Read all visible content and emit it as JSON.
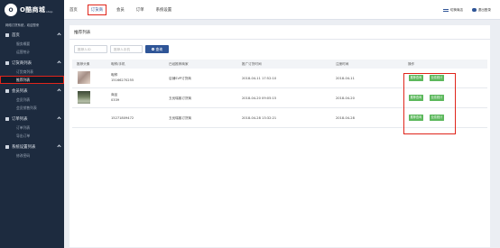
{
  "logo": {
    "mark": "O",
    "title": "O酷商城",
    "sub": "shop"
  },
  "sidebar": {
    "welcome": "网络订货系统，欢迎您来",
    "groups": [
      {
        "label": "首页",
        "items": [
          "服务概要",
          "运营统计"
        ]
      },
      {
        "label": "订货商列表",
        "items": [
          "订货商列表",
          "推荐列表"
        ]
      },
      {
        "label": "会员列表",
        "items": [
          "会员列表",
          "会员销售列表"
        ]
      },
      {
        "label": "订单列表",
        "items": [
          "订单列表",
          "导出订单"
        ]
      },
      {
        "label": "系统设置列表",
        "items": [
          "修改密码"
        ]
      }
    ]
  },
  "topnav": {
    "items": [
      "首页",
      "订货商",
      "会员",
      "订单",
      "系统设置"
    ],
    "active_index": 1
  },
  "topright": {
    "switch_label": "切换商店",
    "logout_label": "退出登录"
  },
  "panel": {
    "title": "推荐列表",
    "search1_placeholder": "推荐人ID",
    "search2_placeholder": "推荐人手机",
    "search_button": "查询"
  },
  "table": {
    "headers": [
      "推荐头像",
      "昵称/手机",
      "已经推荐商家",
      "推广订货时间",
      "注册时间",
      "操作"
    ],
    "rows": [
      {
        "name": "昵称",
        "phone": "15166270255",
        "shop": "店铺SVP订货商",
        "push_time": "2018-04-11 17:52:10",
        "reg_time": "2018-04-11",
        "ops": [
          "推荐查询",
          "业绩统计"
        ]
      },
      {
        "name": "商品",
        "phone": "0339",
        "shop": "五优瑞客订货商",
        "push_time": "2018-04-20 09:05:15",
        "reg_time": "2018-04-20",
        "ops": [
          "推荐查询",
          "业绩统计"
        ]
      },
      {
        "name": "",
        "phone": "15271809472",
        "shop": "五优瑞客订货商",
        "push_time": "2018-04-28 13:32:21",
        "reg_time": "2018-04-28",
        "ops": [
          "推荐查询",
          "业绩统计"
        ]
      }
    ]
  },
  "colors": {
    "sidebar_bg": "#1d2b3f",
    "primary": "#2f5597",
    "op_green": "#5cb85c",
    "highlight_red": "#e0251b"
  }
}
